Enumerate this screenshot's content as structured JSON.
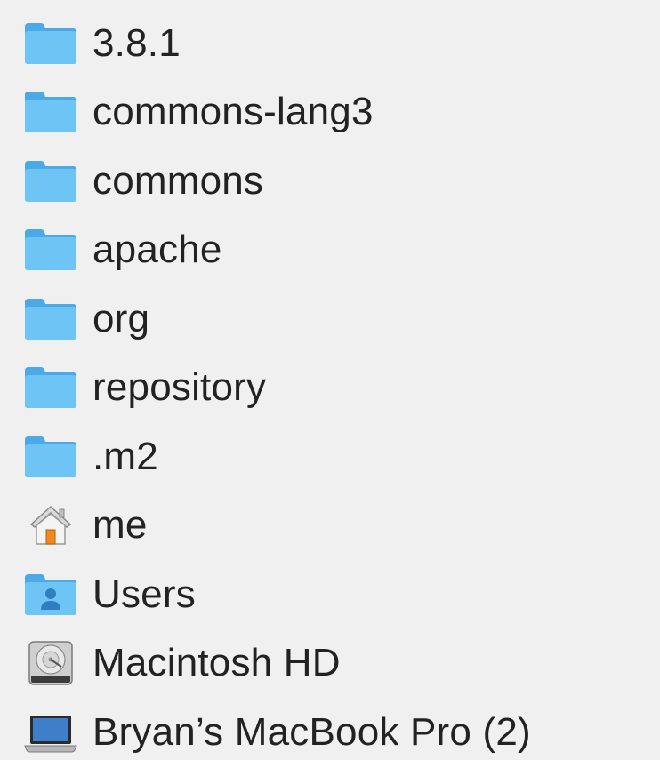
{
  "path_menu": {
    "items": [
      {
        "label": "3.8.1",
        "icon": "folder-icon"
      },
      {
        "label": "commons-lang3",
        "icon": "folder-icon"
      },
      {
        "label": "commons",
        "icon": "folder-icon"
      },
      {
        "label": "apache",
        "icon": "folder-icon"
      },
      {
        "label": "org",
        "icon": "folder-icon"
      },
      {
        "label": "repository",
        "icon": "folder-icon"
      },
      {
        "label": ".m2",
        "icon": "folder-icon"
      },
      {
        "label": "me",
        "icon": "home-icon"
      },
      {
        "label": "Users",
        "icon": "users-folder-icon"
      },
      {
        "label": "Macintosh HD",
        "icon": "hard-drive-icon"
      },
      {
        "label": "Bryan’s MacBook Pro (2)",
        "icon": "laptop-icon"
      }
    ]
  },
  "colors": {
    "background": "#f0f0f0",
    "folder_blue": "#5ab7ee",
    "text": "#222222"
  }
}
